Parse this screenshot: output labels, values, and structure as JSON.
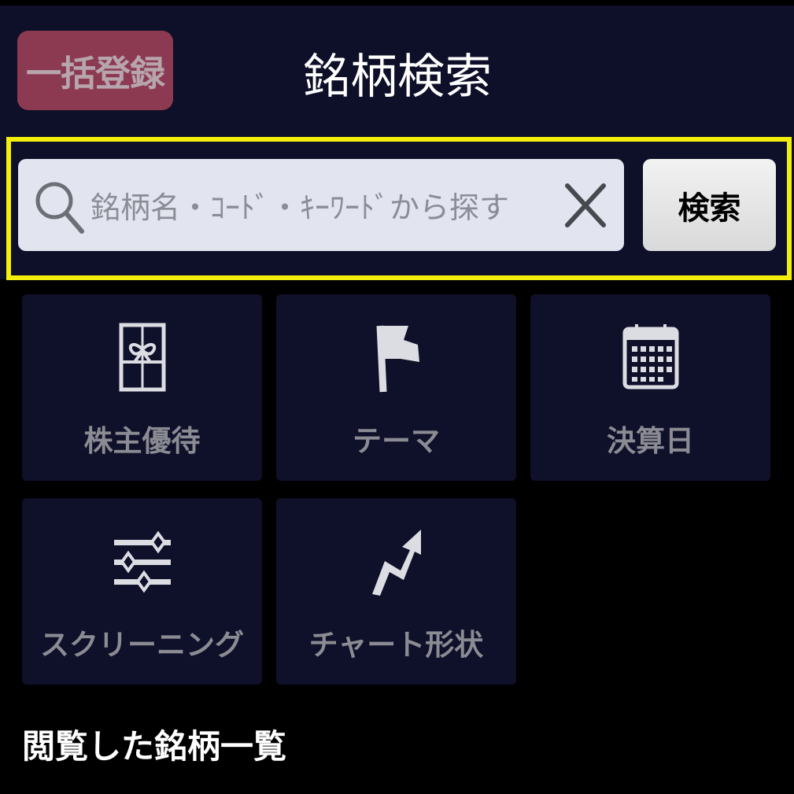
{
  "header": {
    "bulk_register_label": "一括登録",
    "title": "銘柄検索"
  },
  "search": {
    "placeholder": "銘柄名・ｺｰﾄﾞ・ｷｰﾜｰﾄﾞから探す",
    "button_label": "検索",
    "search_icon": "search-icon",
    "clear_icon": "close-icon"
  },
  "categories": [
    {
      "label": "株主優待",
      "icon": "gift-icon"
    },
    {
      "label": "テーマ",
      "icon": "flag-icon"
    },
    {
      "label": "決算日",
      "icon": "calendar-icon"
    },
    {
      "label": "スクリーニング",
      "icon": "sliders-icon"
    },
    {
      "label": "チャート形状",
      "icon": "trend-arrow-icon"
    }
  ],
  "history": {
    "title": "閲覧した銘柄一覧"
  },
  "colors": {
    "highlight": "#f4ef0a",
    "bulk_button": "#8c3a52",
    "header_bg": "#0e0f28"
  }
}
